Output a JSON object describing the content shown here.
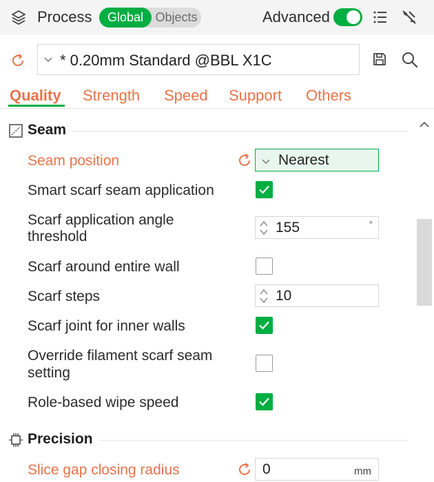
{
  "header": {
    "title": "Process",
    "mode_global": "Global",
    "mode_objects": "Objects",
    "advanced_label": "Advanced",
    "advanced_on": true
  },
  "preset": {
    "name": "* 0.20mm Standard @BBL X1C"
  },
  "tabs": [
    {
      "label": "Quality",
      "active": true
    },
    {
      "label": "Strength"
    },
    {
      "label": "Speed"
    },
    {
      "label": "Support"
    },
    {
      "label": "Others"
    }
  ],
  "sections": {
    "seam": {
      "title": "Seam",
      "options": {
        "seam_position": {
          "label": "Seam position",
          "value": "Nearest",
          "modified": true
        },
        "smart_scarf": {
          "label": "Smart scarf seam application",
          "checked": true
        },
        "scarf_angle": {
          "label_line1": "Scarf application angle",
          "label_line2": "threshold",
          "value": "155",
          "unit": "°"
        },
        "scarf_entire_wall": {
          "label": "Scarf around entire wall",
          "checked": false
        },
        "scarf_steps": {
          "label": "Scarf steps",
          "value": "10"
        },
        "scarf_inner_walls": {
          "label": "Scarf joint for inner walls",
          "checked": true
        },
        "override_filament": {
          "label_line1": "Override filament scarf seam",
          "label_line2": "setting",
          "checked": false
        },
        "role_based_wipe": {
          "label": "Role-based wipe speed",
          "checked": true
        }
      }
    },
    "precision": {
      "title": "Precision",
      "options": {
        "slice_gap": {
          "label": "Slice gap closing radius",
          "value": "0",
          "unit": "mm",
          "modified": true
        }
      }
    }
  },
  "colors": {
    "accent_green": "#00ae42",
    "modified_orange": "#e8734a"
  }
}
